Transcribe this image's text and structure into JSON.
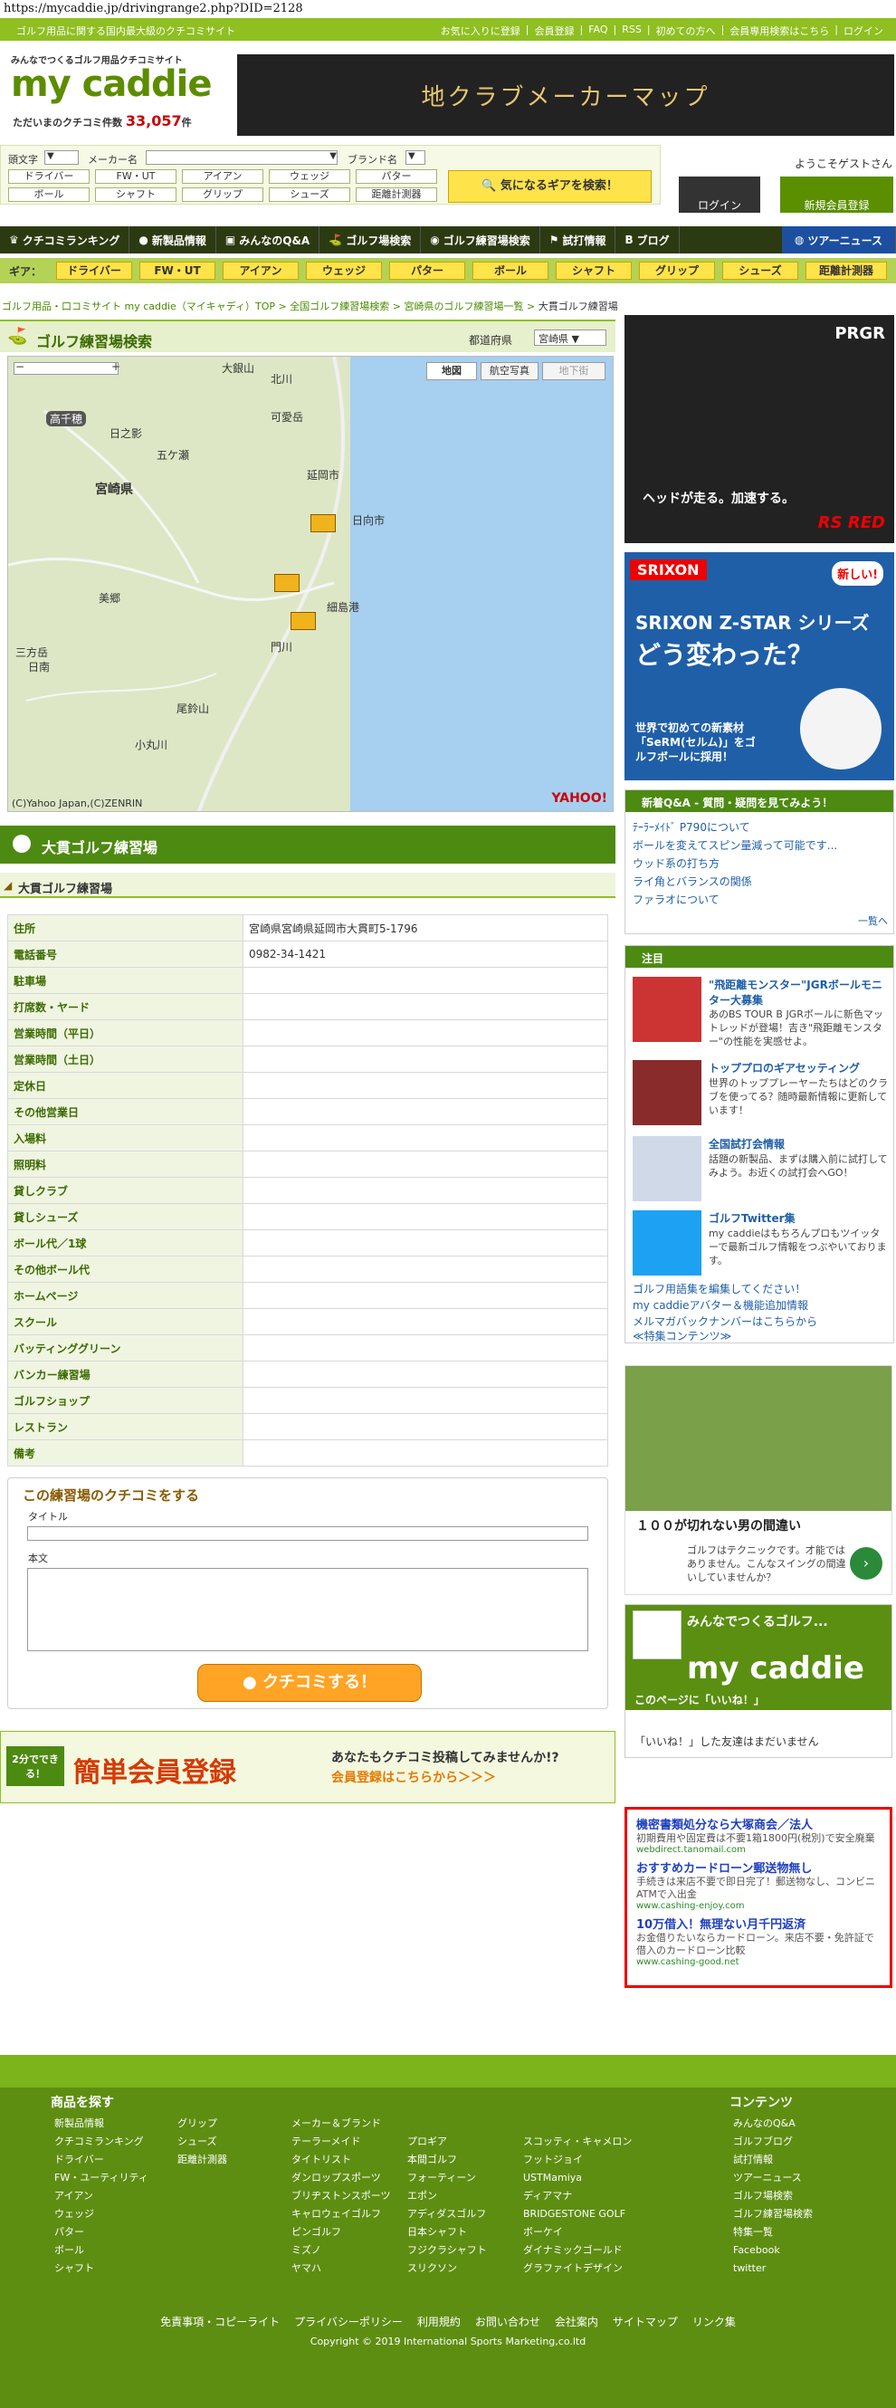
{
  "url": "https://mycaddie.jp/drivingrange2.php?DID=2128",
  "topbar": {
    "tagline": "ゴルフ用品に関する国内最大級のクチコミサイト",
    "links": [
      "お気に入りに登録",
      "会員登録",
      "FAQ",
      "RSS",
      "初めての方へ",
      "会員専用検索はこちら",
      "ログイン"
    ]
  },
  "logo": {
    "tag": "みんなでつくるゴルフ用品クチコミサイト",
    "name": "my caddie",
    "count_label": "ただいまのクチコミ件数",
    "count": "33,057",
    "count_unit": "件"
  },
  "banner_map": "地クラブメーカーマップ",
  "search": {
    "initial_label": "頭文字",
    "maker_label": "メーカー名",
    "brand_label": "ブランド名",
    "chips": [
      "ドライバー",
      "FW・UT",
      "アイアン",
      "ウェッジ",
      "パター",
      "ボール",
      "シャフト",
      "グリップ",
      "シューズ",
      "距離計測器"
    ],
    "button": "気になるギアを検索！"
  },
  "account": {
    "welcome": "ようこそゲストさん",
    "login": "ログイン",
    "register": "新規会員登録"
  },
  "mainnav": [
    "クチコミランキング",
    "新製品情報",
    "みんなのQ&A",
    "ゴルフ場検索",
    "ゴルフ練習場検索",
    "試打情報",
    "ブログ",
    "ツアーニュース"
  ],
  "gearbar": {
    "label": "ギア：",
    "tabs": [
      "ドライバー",
      "FW・UT",
      "アイアン",
      "ウェッジ",
      "パター",
      "ボール",
      "シャフト",
      "グリップ",
      "シューズ",
      "距離計測器"
    ]
  },
  "breadcrumb": {
    "items": [
      "ゴルフ用品・口コミサイト my caddie（マイキャディ）TOP",
      "全国ゴルフ練習場検索",
      "宮崎県のゴルフ練習場一覧"
    ],
    "current": "大貫ゴルフ練習場",
    "sep": ">"
  },
  "map_search": {
    "title": "ゴルフ練習場検索",
    "prefecture_label": "都道府県",
    "prefecture_value": "宮崎県",
    "map_types": [
      "地図",
      "航空写真",
      "地下街"
    ],
    "places": [
      "宮崎県",
      "高千穂",
      "大銀山",
      "延岡市",
      "日向市",
      "細島港",
      "美郷",
      "門川",
      "小丸川",
      "尾鈴山",
      "三方岳",
      "日之影",
      "日南",
      "可愛岳",
      "北川",
      "五ケ瀬"
    ],
    "copyright": "(C)Yahoo Japan,(C)ZENRIN",
    "yahoo": "YAHOO!"
  },
  "range": {
    "title": "大貫ゴルフ練習場",
    "subtitle": "大貫ゴルフ練習場",
    "rows": [
      {
        "k": "住所",
        "v": "宮崎県宮崎県延岡市大貫町5-1796"
      },
      {
        "k": "電話番号",
        "v": "0982-34-1421"
      },
      {
        "k": "駐車場",
        "v": ""
      },
      {
        "k": "打席数・ヤード",
        "v": ""
      },
      {
        "k": "営業時間（平日）",
        "v": ""
      },
      {
        "k": "営業時間（土日）",
        "v": ""
      },
      {
        "k": "定休日",
        "v": ""
      },
      {
        "k": "その他営業日",
        "v": ""
      },
      {
        "k": "入場料",
        "v": ""
      },
      {
        "k": "照明料",
        "v": ""
      },
      {
        "k": "貸しクラブ",
        "v": ""
      },
      {
        "k": "貸しシューズ",
        "v": ""
      },
      {
        "k": "ボール代／1球",
        "v": ""
      },
      {
        "k": "その他ボール代",
        "v": ""
      },
      {
        "k": "ホームページ",
        "v": ""
      },
      {
        "k": "スクール",
        "v": ""
      },
      {
        "k": "バッティンググリーン",
        "v": ""
      },
      {
        "k": "バンカー練習場",
        "v": ""
      },
      {
        "k": "ゴルフショップ",
        "v": ""
      },
      {
        "k": "レストラン",
        "v": ""
      },
      {
        "k": "備考",
        "v": ""
      }
    ]
  },
  "review": {
    "title": "この練習場のクチコミをする",
    "title_label": "タイトル",
    "body_label": "本文",
    "submit": "クチコミする！"
  },
  "reg_banner": {
    "badge": "2分でできる！",
    "big": "簡単会員登録",
    "text": "あなたもクチコミ投稿してみませんか!?",
    "link": "会員登録はこちらから＞＞＞"
  },
  "ad1": {
    "brand": "PRGR",
    "l1": "ヘッドが走る。加速する。",
    "l2": "RS RED"
  },
  "ad2": {
    "brand": "SRIXON",
    "l1": "SRIXON Z-STAR シリーズ",
    "l2": "どう変わった？",
    "l3": "世界で初めての新素材「SeRM(セルム)」をゴルフボールに採用！",
    "badge": "新しい!"
  },
  "qa": {
    "title": "新着Q&A - 質問・疑問を見てみよう！",
    "items": [
      "ﾃｰﾗｰﾒｲﾄﾞ P790について",
      "ボールを変えてスピン量減って可能です...",
      "ウッド系の打ち方",
      "ライ角とバランスの関係",
      "ファラオについて"
    ],
    "more": "一覧へ"
  },
  "notice": {
    "title": "注目",
    "items": [
      {
        "t": "\"飛距離モンスター\"JGRボールモニター大募集",
        "d": "あのBS TOUR B JGRボールに新色マットレッドが登場！吉き\"飛距離モンスター\"の性能を実感せよ。"
      },
      {
        "t": "トッププロのギアセッティング",
        "d": "世界のトッププレーヤーたちはどのクラブを使ってる？随時最新情報に更新しています！"
      },
      {
        "t": "全国試打会情報",
        "d": "話題の新製品、まずは購入前に試打してみよう。お近くの試打会へGO！"
      },
      {
        "t": "ゴルフTwitter集",
        "d": "my caddieはもちろんプロもツイッターで最新ゴルフ情報をつぶやいております。"
      }
    ],
    "links": [
      "ゴルフ用語集を編集してください！",
      "my caddieアバター＆機能追加情報",
      "メルマガバックナンバーはこちらから",
      "≪特集コンテンツ≫"
    ]
  },
  "ad3": {
    "headline": "１００が切れない男の間違い",
    "desc": "ゴルフはテクニックです。才能ではありません。こんなスイングの間違いしていませんか？"
  },
  "fb": {
    "title": "みんなでつくるゴルフ...",
    "logo": "my caddie",
    "like": "このページに「いいね！」",
    "friends": "「いいね！」した友達はまだいません"
  },
  "ad4": [
    {
      "t": "機密書類処分なら大塚商会／法人",
      "d": "初期費用や固定費は不要1箱1800円(税別)で安全廃棄",
      "u": "webdirect.tanomail.com"
    },
    {
      "t": "おすすめカードローン郵送物無し",
      "d": "手続きは来店不要で即日完了！郵送物なし、コンビニATMで入出金",
      "u": "www.cashing-enjoy.com"
    },
    {
      "t": "10万借入！無理ない月千円返済",
      "d": "お金借りたいならカードローン。来店不要・免許証で借入のカードローン比較",
      "u": "www.cashing-good.net"
    }
  ],
  "footer": {
    "left_title": "商品を探す",
    "right_title": "コンテンツ",
    "col1": [
      "新製品情報",
      "クチコミランキング",
      "ドライバー",
      "FW・ユーティリティ",
      "アイアン",
      "ウェッジ",
      "パター",
      "ボール",
      "シャフト"
    ],
    "col2": [
      "グリップ",
      "シューズ",
      "距離計測器"
    ],
    "brand_title": "メーカー＆ブランド",
    "col3": [
      "テーラーメイド",
      "タイトリスト",
      "ダンロップスポーツ",
      "ブリヂストンスポーツ",
      "キャロウェイゴルフ",
      "ピンゴルフ",
      "ミズノ",
      "ヤマハ"
    ],
    "col4": [
      "プロギア",
      "本間ゴルフ",
      "フォーティーン",
      "エポン",
      "アディダスゴルフ",
      "日本シャフト",
      "フジクラシャフト",
      "スリクソン"
    ],
    "col5": [
      "スコッティ・キャメロン",
      "フットジョイ",
      "USTMamiya",
      "ディアマナ",
      "BRIDGESTONE GOLF",
      "ボーケイ",
      "ダイナミックゴールド",
      "グラファイトデザイン"
    ],
    "col6": [
      "みんなのQ&A",
      "ゴルフブログ",
      "試打情報",
      "ツアーニュース",
      "ゴルフ場検索",
      "ゴルフ練習場検索",
      "特集一覧",
      "Facebook",
      "twitter"
    ],
    "links": [
      "免責事項・コピーライト",
      "プライバシーポリシー",
      "利用規約",
      "お問い合わせ",
      "会社案内",
      "サイトマップ",
      "リンク集"
    ],
    "copyright": "Copyright © 2019 International Sports Marketing,co.ltd"
  }
}
